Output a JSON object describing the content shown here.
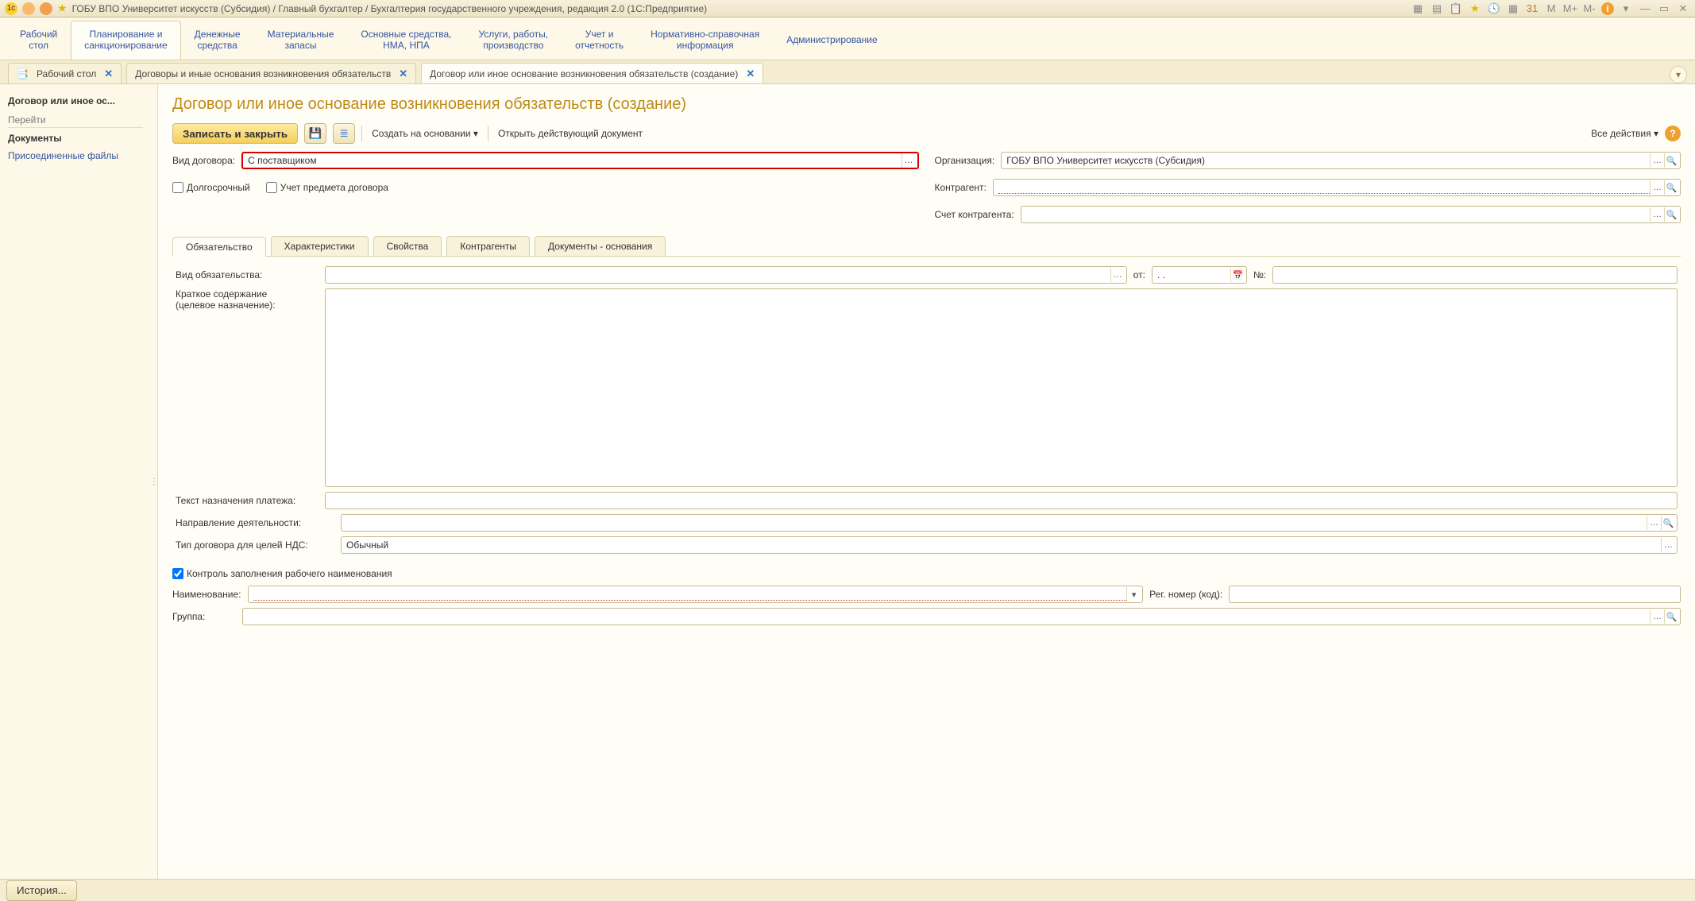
{
  "window": {
    "title": "ГОБУ ВПО Университет искусств (Субсидия) / Главный бухгалтер / Бухгалтерия государственного учреждения, редакция 2.0  (1С:Предприятие)"
  },
  "sections": [
    {
      "l1": "Рабочий",
      "l2": "стол"
    },
    {
      "l1": "Планирование и",
      "l2": "санкционирование"
    },
    {
      "l1": "Денежные",
      "l2": "средства"
    },
    {
      "l1": "Материальные",
      "l2": "запасы"
    },
    {
      "l1": "Основные средства,",
      "l2": "НМА, НПА"
    },
    {
      "l1": "Услуги, работы,",
      "l2": "производство"
    },
    {
      "l1": "Учет и",
      "l2": "отчетность"
    },
    {
      "l1": "Нормативно-справочная",
      "l2": "информация"
    },
    {
      "l1": "Администрирование",
      "l2": ""
    }
  ],
  "tabs": [
    {
      "label": "Рабочий стол",
      "icon": "📄"
    },
    {
      "label": "Договоры и иные основания возникновения обязательств"
    },
    {
      "label": "Договор или иное основание возникновения обязательств (создание)",
      "active": true
    }
  ],
  "sidebar": {
    "title": "Договор или иное ос...",
    "section": "Перейти",
    "documents": "Документы",
    "attached": "Присоединенные файлы"
  },
  "page": {
    "title": "Договор или иное основание возникновения обязательств (создание)",
    "toolbar": {
      "save_close": "Записать и закрыть",
      "create_based": "Создать на основании",
      "open_current": "Открыть действующий документ",
      "all_actions": "Все действия"
    },
    "form": {
      "contract_type_label": "Вид договора:",
      "contract_type_value": "С поставщиком",
      "org_label": "Организация:",
      "org_value": "ГОБУ ВПО Университет искусств (Субсидия)",
      "longterm": "Долгосрочный",
      "subject_acc": "Учет предмета договора",
      "counterparty_label": "Контрагент:",
      "counterparty_acc_label": "Счет контрагента:",
      "inner_tabs": [
        "Обязательство",
        "Характеристики",
        "Свойства",
        "Контрагенты",
        "Документы - основания"
      ],
      "obligation_type_label": "Вид обязательства:",
      "from_label": "от:",
      "from_value": ". .",
      "num_label": "№:",
      "short_desc_l1": "Краткое содержание",
      "short_desc_l2": "(целевое назначение):",
      "payment_text_label": "Текст назначения платежа:",
      "activity_dir_label": "Направление деятельности:",
      "nds_type_label": "Тип договора для целей НДС:",
      "nds_type_value": "Обычный",
      "control_name": "Контроль заполнения рабочего наименования",
      "name_label": "Наименование:",
      "reg_num_label": "Рег. номер (код):",
      "group_label": "Группа:"
    }
  },
  "footer": {
    "history": "История..."
  }
}
